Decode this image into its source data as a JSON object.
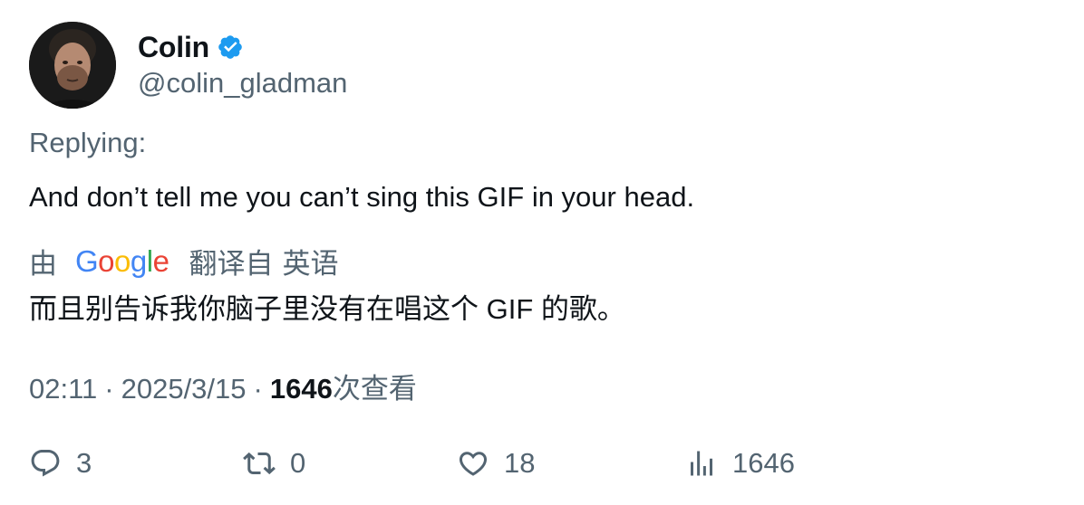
{
  "author": {
    "display_name": "Colin",
    "handle": "@colin_gladman",
    "verified_color": "#1d9bf0"
  },
  "tweet": {
    "replying_label": "Replying:",
    "text": "And don’t tell me you can’t sing this GIF in your head."
  },
  "translation": {
    "prefix": "由",
    "engine": "Google",
    "suffix_from": "翻译自",
    "language": "英语",
    "text": "而且别告诉我你脑子里没有在唱这个 GIF 的歌。"
  },
  "meta": {
    "time": "02:11",
    "separator": "·",
    "date": "2025/3/15",
    "views_count": "1646",
    "views_label": "次查看"
  },
  "actions": {
    "replies": "3",
    "retweets": "0",
    "likes": "18",
    "views": "1646"
  },
  "icons": {
    "verified": "verified-badge-icon",
    "reply": "speech-bubble-icon",
    "retweet": "retweet-icon",
    "like": "heart-icon",
    "views": "bar-chart-icon"
  },
  "colors": {
    "text_primary": "#0f1419",
    "text_secondary": "#536471",
    "accent": "#1d9bf0"
  }
}
